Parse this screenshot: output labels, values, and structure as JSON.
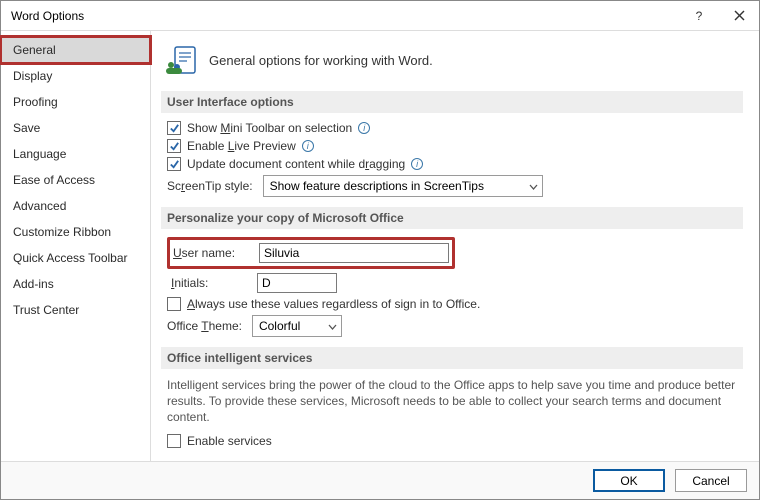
{
  "window": {
    "title": "Word Options"
  },
  "sidebar": {
    "items": [
      {
        "label": "General"
      },
      {
        "label": "Display"
      },
      {
        "label": "Proofing"
      },
      {
        "label": "Save"
      },
      {
        "label": "Language"
      },
      {
        "label": "Ease of Access"
      },
      {
        "label": "Advanced"
      },
      {
        "label": "Customize Ribbon"
      },
      {
        "label": "Quick Access Toolbar"
      },
      {
        "label": "Add-ins"
      },
      {
        "label": "Trust Center"
      }
    ]
  },
  "intro": {
    "text": "General options for working with Word."
  },
  "ui_section": {
    "title": "User Interface options",
    "mini_toolbar": {
      "pre": "Show ",
      "u": "M",
      "post": "ini Toolbar on selection"
    },
    "live_preview": {
      "pre": "Enable ",
      "u": "L",
      "post": "ive Preview"
    },
    "drag_update": {
      "pre": "Update document content while d",
      "u": "r",
      "post": "agging"
    },
    "screentip_label": {
      "pre": "Sc",
      "u": "r",
      "post": "eenTip style:"
    },
    "screentip_value": "Show feature descriptions in ScreenTips"
  },
  "personalize_section": {
    "title": "Personalize your copy of Microsoft Office",
    "username_label": {
      "u": "U",
      "post": "ser name:"
    },
    "username_value": "Siluvia",
    "initials_label": {
      "u": "I",
      "post": "nitials:"
    },
    "initials_value": "D",
    "always_use": {
      "u": "A",
      "post": "lways use these values regardless of sign in to Office."
    },
    "theme_label": {
      "pre": "Office ",
      "u": "T",
      "post": "heme:"
    },
    "theme_value": "Colorful"
  },
  "intel_section": {
    "title": "Office intelligent services",
    "blurb": "Intelligent services bring the power of the cloud to the Office apps to help save you time and produce better results. To provide these services, Microsoft needs to be able to collect your search terms and document content.",
    "enable_services": "Enable services"
  },
  "footer": {
    "ok": "OK",
    "cancel": "Cancel"
  }
}
